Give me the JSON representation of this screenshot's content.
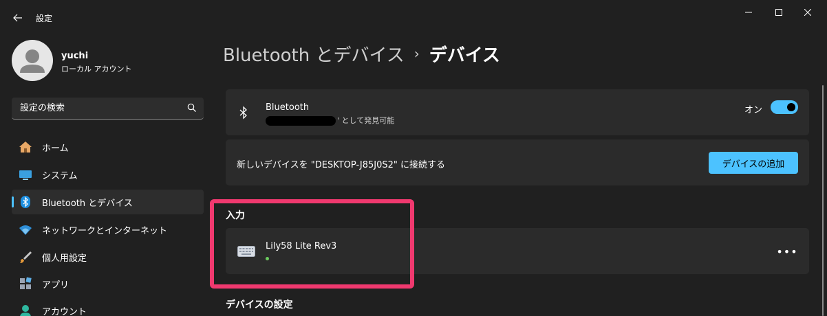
{
  "window": {
    "title": "設定",
    "icons": {
      "back": "back-arrow-icon",
      "minimize": "minimize-icon",
      "maximize": "maximize-icon",
      "close": "close-icon"
    }
  },
  "profile": {
    "name": "yuchi",
    "account_type": "ローカル アカウント"
  },
  "search": {
    "placeholder": "設定の検索",
    "icon": "search-icon"
  },
  "sidebar": {
    "items": [
      {
        "label": "ホーム",
        "icon": "home-icon",
        "active": false
      },
      {
        "label": "システム",
        "icon": "system-icon",
        "active": false
      },
      {
        "label": "Bluetooth とデバイス",
        "icon": "bluetooth-icon",
        "active": true
      },
      {
        "label": "ネットワークとインターネット",
        "icon": "wifi-icon",
        "active": false
      },
      {
        "label": "個人用設定",
        "icon": "brush-icon",
        "active": false
      },
      {
        "label": "アプリ",
        "icon": "apps-icon",
        "active": false
      },
      {
        "label": "アカウント",
        "icon": "account-icon",
        "active": false
      }
    ]
  },
  "breadcrumb": {
    "parent": "Bluetooth とデバイス",
    "separator": "›",
    "current": "デバイス"
  },
  "bluetooth_card": {
    "title": "Bluetooth",
    "discoverable_suffix": "' として発見可能",
    "toggle_label": "オン",
    "toggle_on": true
  },
  "add_device_card": {
    "text": "新しいデバイスを \"DESKTOP-J85J0S2\" に接続する",
    "button_label": "デバイスの追加"
  },
  "input_section": {
    "heading": "入力",
    "device_name": "Lily58 Lite Rev3",
    "device_icon": "keyboard-icon",
    "more_label": "•••"
  },
  "device_settings": {
    "heading": "デバイスの設定"
  },
  "colors": {
    "accent": "#4cc2ff",
    "background": "#202020",
    "card": "#2b2b2b",
    "highlight": "#f0396f",
    "status_connected": "#6ccb5f"
  }
}
